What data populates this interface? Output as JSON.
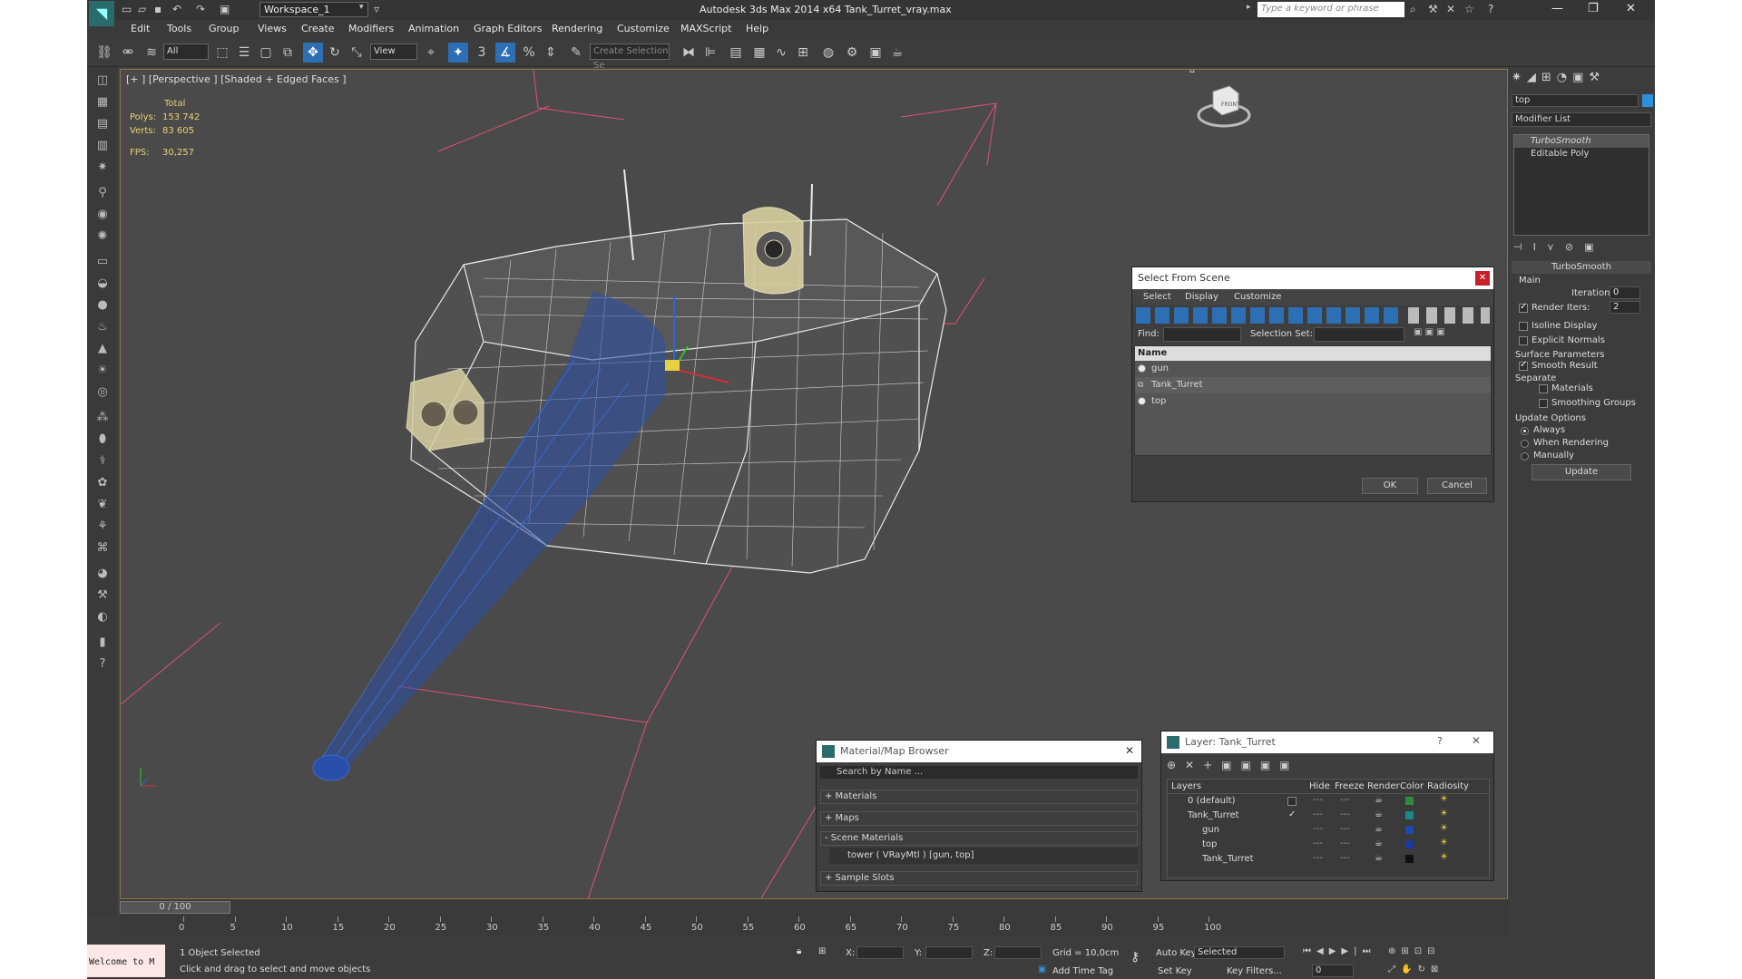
{
  "titlebar": {
    "workspace": "Workspace_1",
    "title": "Autodesk 3ds Max  2014 x64     Tank_Turret_vray.max",
    "search_placeholder": "Type a keyword or phrase"
  },
  "menu": [
    "Edit",
    "Tools",
    "Group",
    "Views",
    "Create",
    "Modifiers",
    "Animation",
    "Graph Editors",
    "Rendering",
    "Customize",
    "MAXScript",
    "Help"
  ],
  "toolbar": {
    "filter": "All",
    "ref_coord": "View",
    "named_sel": "Create Selection Se",
    "snap_label": "3",
    "angle_snap": "%"
  },
  "viewport": {
    "label": "[+ ] [Perspective ] [Shaded + Edged Faces ]",
    "stats": {
      "total": "Total",
      "polys_label": "Polys:",
      "polys": "153 742",
      "verts_label": "Verts:",
      "verts": "83 605",
      "fps_label": "FPS:",
      "fps": "30,257"
    },
    "viewcube_label": "FRONT"
  },
  "select_from_scene": {
    "title": "Select From Scene",
    "menu": [
      "Select",
      "Display",
      "Customize"
    ],
    "find_label": "Find:",
    "selset_label": "Selection Set:",
    "col_name": "Name",
    "items": [
      "gun",
      "Tank_Turret",
      "top"
    ],
    "ok": "OK",
    "cancel": "Cancel"
  },
  "material_browser": {
    "title": "Material/Map Browser",
    "search": "Search by Name ...",
    "sections": [
      "+ Materials",
      "+ Maps",
      "- Scene Materials"
    ],
    "scene_item": "tower  ( VRayMtl )  [gun, top]",
    "sample": "+ Sample Slots"
  },
  "layer_dialog": {
    "title": "Layer: Tank_Turret",
    "help": "?",
    "cols": [
      "Layers",
      "Hide",
      "Freeze",
      "Render",
      "Color",
      "Radiosity"
    ],
    "rows": [
      {
        "name": "0 (default)",
        "color": "#2e8b3a"
      },
      {
        "name": "Tank_Turret",
        "color": "#1a8a8a"
      },
      {
        "name": "gun",
        "color": "#1a4ab0"
      },
      {
        "name": "top",
        "color": "#1a3aa0"
      },
      {
        "name": "Tank_Turret",
        "color": "#111111"
      }
    ]
  },
  "cmdpanel": {
    "name_field": "top",
    "modifier_list": "Modifier List",
    "stack": [
      "TurboSmooth",
      "Editable Poly"
    ],
    "rollout_title": "TurboSmooth",
    "main": "Main",
    "iterations_label": "Iterations:",
    "iterations": "0",
    "render_iters_label": "Render Iters:",
    "render_iters": "2",
    "isoline": "Isoline Display",
    "explicit": "Explicit Normals",
    "surface": "Surface Parameters",
    "smooth": "Smooth Result",
    "separate": "Separate",
    "materials": "Materials",
    "smoothing": "Smoothing Groups",
    "update_opts": "Update Options",
    "always": "Always",
    "when_rendering": "When Rendering",
    "manually": "Manually",
    "update_btn": "Update"
  },
  "timeline": {
    "frame": "0 / 100",
    "ticks": [
      "0",
      "5",
      "10",
      "15",
      "20",
      "25",
      "30",
      "35",
      "40",
      "45",
      "50",
      "55",
      "60",
      "65",
      "70",
      "75",
      "80",
      "85",
      "90",
      "95",
      "100"
    ]
  },
  "status": {
    "maxscript": "Welcome to M",
    "selected": "1 Object Selected",
    "prompt": "Click and drag to select and move objects",
    "x_label": "X:",
    "y_label": "Y:",
    "z_label": "Z:",
    "grid": "Grid = 10,0cm",
    "add_tag": "Add Time Tag",
    "auto_key": "Auto Key",
    "set_key": "Set Key",
    "key_mode": "Selected",
    "key_filters": "Key Filters...",
    "frame_field": "0"
  },
  "colors": {
    "accent": "#2d6fb5",
    "bg": "#444444",
    "viewport_bg": "#4a4a4a",
    "wire": "#ffffff",
    "gun_wire": "#2a4fa8",
    "bbox": "#e0507a"
  }
}
